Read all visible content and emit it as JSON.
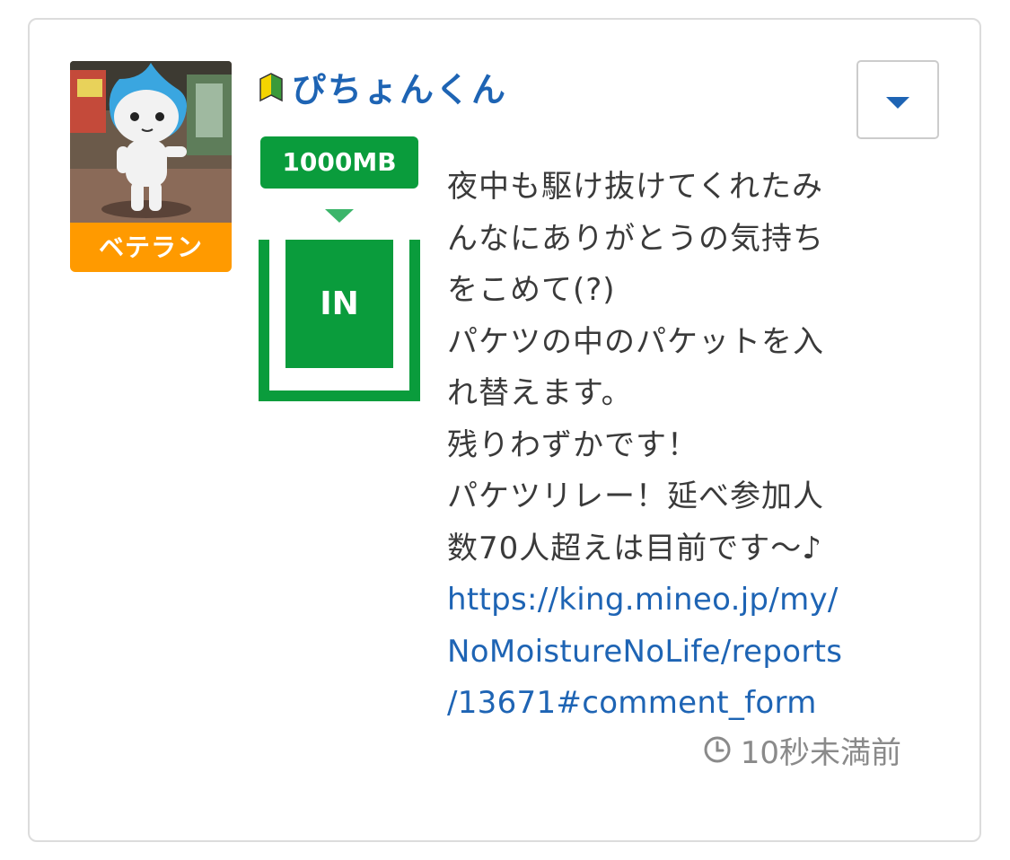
{
  "post": {
    "user": {
      "name": "ぴちょんくん",
      "rank_badge": "ベテラン",
      "beginner_mark_icon": "beginner-mark-icon",
      "avatar_icon": "character-avatar"
    },
    "menu_icon": "chevron-down-icon",
    "packet": {
      "amount": "1000MB",
      "direction": "IN",
      "bucket_level": 0.85
    },
    "message": "夜中も駆け抜けてくれたみ\nんなにありがとうの気持ち\nをこめて(?)\nパケツの中のパケットを入\nれ替えます。\n残りわずかです！\nパケツリレー！延べ参加人\n数70人超えは目前です〜♪",
    "link": "https://king.mineo.jp/my/\nNoMoistureNoLife/reports\n/13671#comment_form",
    "timestamp": "10秒未満前",
    "timestamp_icon": "clock-icon"
  },
  "colors": {
    "accent_blue": "#1e64b4",
    "badge_orange": "#ff9a00",
    "packet_green": "#0a9c3c",
    "border": "#dcdcdc",
    "text": "#3a3a3a",
    "muted": "#8a8a8a"
  }
}
